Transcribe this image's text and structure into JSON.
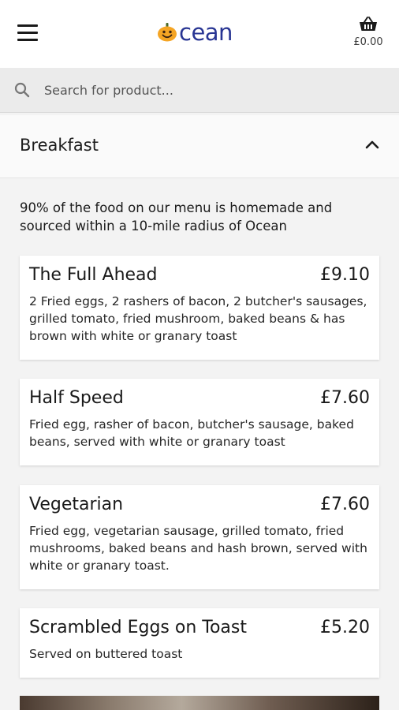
{
  "header": {
    "logo_text": "cean",
    "cart_total": "£0.00"
  },
  "search": {
    "placeholder": "Search for product..."
  },
  "section": {
    "title": "Breakfast"
  },
  "intro": "90% of the food on our menu is homemade and sourced within a 10-mile radius of Ocean",
  "items": [
    {
      "name": "The Full Ahead",
      "price": "£9.10",
      "description": "2 Fried eggs, 2 rashers of bacon, 2 butcher's sausages, grilled tomato, fried mushroom, baked beans & has brown with white or granary toast"
    },
    {
      "name": "Half Speed",
      "price": "£7.60",
      "description": "Fried egg, rasher of bacon, butcher's sausage, baked beans, served with white or granary toast"
    },
    {
      "name": "Vegetarian",
      "price": "£7.60",
      "description": "Fried egg, vegetarian sausage, grilled tomato, fried mushrooms, baked beans and hash brown, served with white or granary toast."
    },
    {
      "name": "Scrambled Eggs on Toast",
      "price": "£5.20",
      "description": "Served on buttered toast"
    }
  ],
  "icons": {
    "menu": "hamburger-menu-icon",
    "cart": "basket-icon",
    "search": "search-icon",
    "collapse": "chevron-up-icon",
    "logo": "pumpkin-logo-icon"
  },
  "colors": {
    "logo_orange": "#f5a524",
    "logo_blue": "#283593",
    "header_bg": "#ffffff",
    "search_bg": "#ebebeb",
    "page_bg": "#f3f3f3"
  }
}
